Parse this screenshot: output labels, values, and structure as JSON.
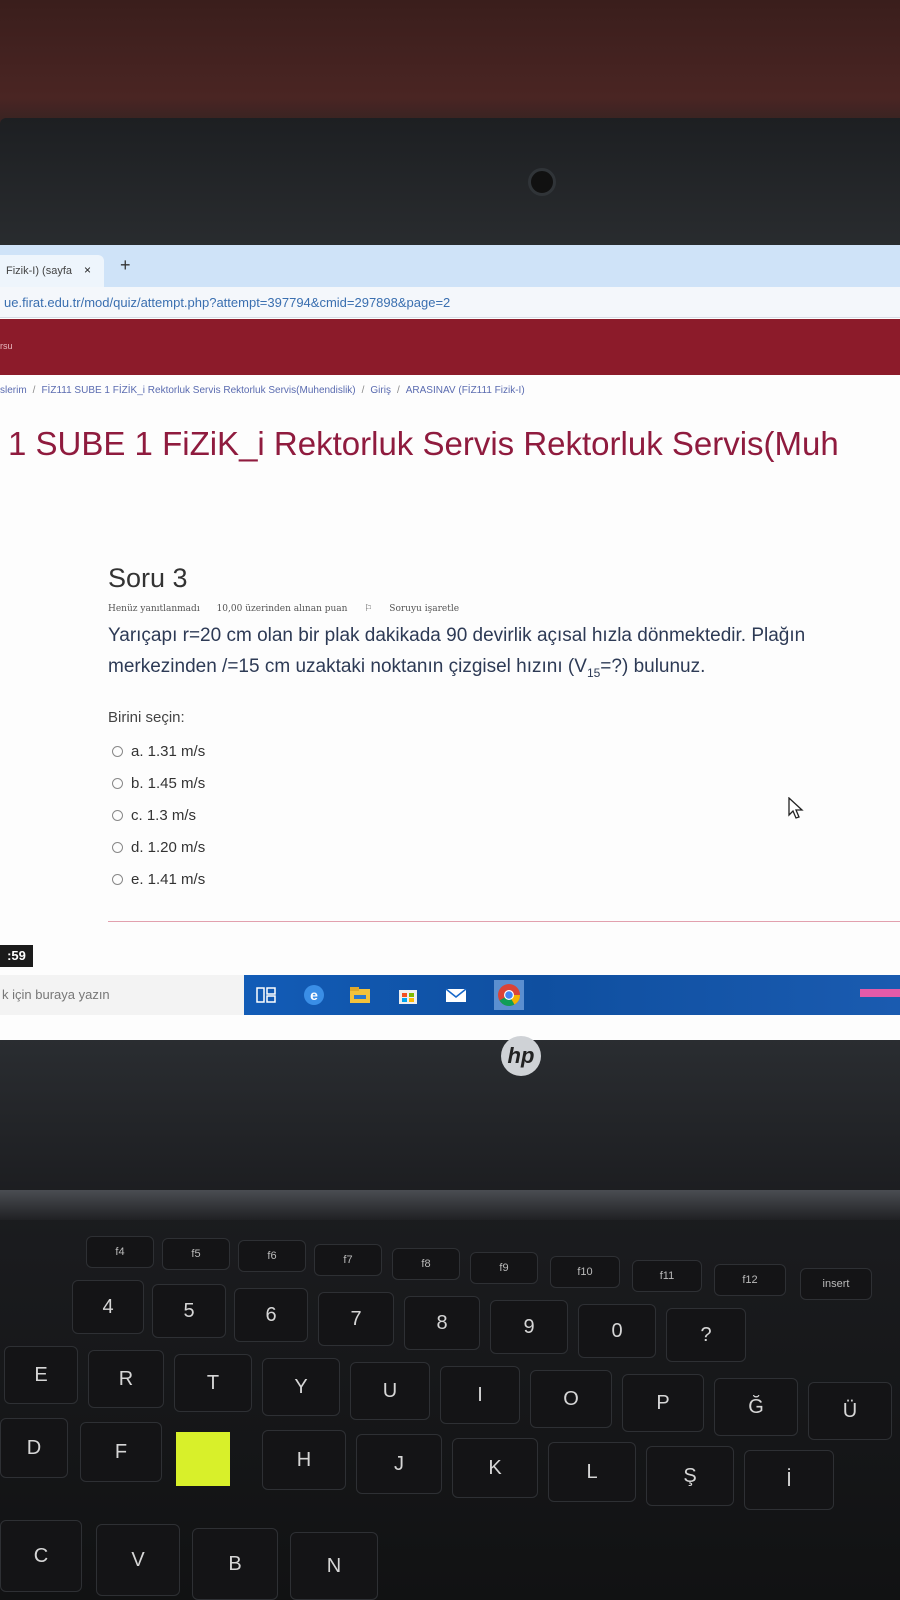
{
  "browser": {
    "tab_title": "Fizik-I) (sayfa",
    "tab_close": "×",
    "new_tab": "+",
    "url": "ue.firat.edu.tr/mod/quiz/attempt.php?attempt=397794&cmid=297898&page=2"
  },
  "site": {
    "header_label": "rsu",
    "breadcrumb": [
      "slerim",
      "FİZ111 SUBE 1 FİZİK_i Rektorluk Servis Rektorluk Servis(Muhendislik)",
      "Giriş",
      "ARASINAV (FİZ111 Fizik-I)"
    ],
    "course_title": "1 SUBE 1 FiZiK_i Rektorluk Servis Rektorluk Servis(Muh"
  },
  "question": {
    "number": "Soru 3",
    "status": "Henüz yanıtlanmadı",
    "points": "10,00 üzerinden alınan puan",
    "flag_icon": "flag-icon",
    "flag": "Soruyu işaretle",
    "text_line1": "Yarıçapı r=20 cm olan bir plak dakikada 90 devirlik açısal hızla dönmektedir. Plağın",
    "text_line2_a": "merkezinden /=15 cm  uzaktaki noktanın çizgisel hızını (V",
    "text_sub": "15",
    "text_line2_b": "=?) bulunuz.",
    "prompt": "Birini seçin:",
    "options": [
      "a. 1.31 m/s",
      "b. 1.45 m/s",
      "c. 1.3 m/s",
      "d. 1.20 m/s",
      "e. 1.41 m/s"
    ]
  },
  "taskbar": {
    "clock": ":59",
    "search_placeholder": "k için buraya yazın",
    "icons": [
      "task-view-icon",
      "edge-icon",
      "file-explorer-icon",
      "store-icon",
      "mail-icon",
      "chrome-icon"
    ]
  },
  "laptop": {
    "brand": "hp",
    "fn_keys": [
      "f4",
      "f5",
      "f6",
      "f7",
      "f8",
      "f9",
      "f10",
      "f11",
      "f12",
      "insert"
    ],
    "num_keys": [
      "4",
      "5",
      "6",
      "7",
      "8",
      "9",
      "0",
      "?"
    ],
    "row_q": [
      "E",
      "R",
      "T",
      "Y",
      "U",
      "I",
      "O",
      "P",
      "Ğ",
      "Ü"
    ],
    "row_a": [
      "D",
      "F",
      "H",
      "J",
      "K",
      "L",
      "Ş",
      "İ"
    ],
    "row_z": [
      "C",
      "V",
      "B",
      "N"
    ]
  },
  "colors": {
    "accent": "#8c1b2a",
    "title": "#8f1b3e",
    "link": "#3a6fb0"
  }
}
